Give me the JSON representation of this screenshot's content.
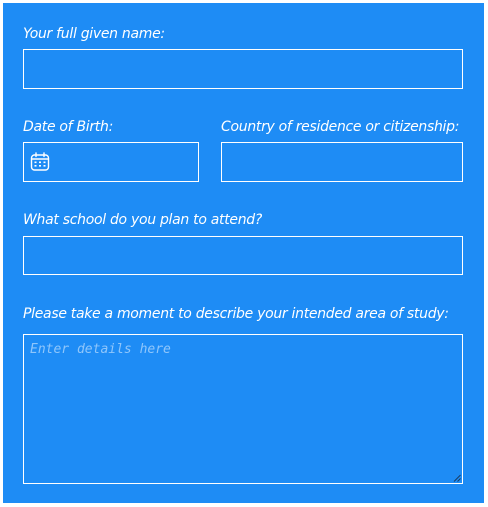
{
  "form": {
    "full_name": {
      "label": "Your full given name:",
      "value": ""
    },
    "dob": {
      "label": "Date of Birth:",
      "value": "",
      "icon": "calendar-icon"
    },
    "country": {
      "label": "Country of residence or citizenship:",
      "value": ""
    },
    "school": {
      "label": "What school do you plan to attend?",
      "value": ""
    },
    "study": {
      "label": "Please take a moment to describe your intended area of study:",
      "placeholder": "Enter details here",
      "value": ""
    }
  },
  "colors": {
    "panel_background": "#1e8cf5",
    "text": "#ffffff",
    "placeholder": "#8fc6fb"
  }
}
